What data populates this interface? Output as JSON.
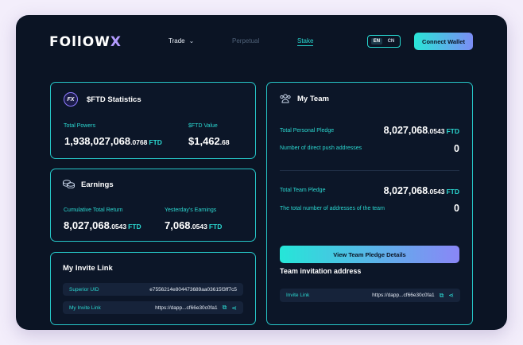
{
  "header": {
    "logo_main": "FOllOW",
    "logo_x": "X",
    "nav": {
      "trade": "Trade",
      "perpetual": "Perpetual",
      "stake": "Stake"
    },
    "lang": {
      "en": "EN",
      "cn": "CN"
    },
    "connect_label": "Connect Wallet"
  },
  "stats": {
    "icon_text": "FX",
    "title": "$FTD Statistics",
    "total_powers_label": "Total Powers",
    "total_powers_int": "1,938,027,068",
    "total_powers_dec": ".0768",
    "total_powers_unit": "FTD",
    "ftd_value_label": "$FTD Value",
    "ftd_value_int": "$1,462",
    "ftd_value_dec": ".68"
  },
  "earnings": {
    "title": "Earnings",
    "cumulative_label": "Cumulative Total Return",
    "cumulative_int": "8,027,068",
    "cumulative_dec": ".0543",
    "cumulative_unit": "FTD",
    "yesterday_label": "Yesterday's Earnings",
    "yesterday_int": "7,068",
    "yesterday_dec": ".0543",
    "yesterday_unit": "FTD"
  },
  "invite": {
    "title": "My Invite Link",
    "superior_label": "Superior UID",
    "superior_value": "e7556214e804473689aa03615f3ff7c5",
    "link_label": "My Invite Link",
    "link_value": "https://dapp...cf66e30c0fa1"
  },
  "team": {
    "title": "My Team",
    "personal_pledge_label": "Total Personal Pledge",
    "personal_pledge_int": "8,027,068",
    "personal_pledge_dec": ".0543",
    "personal_pledge_unit": "FTD",
    "direct_push_label": "Number of direct push addresses",
    "direct_push_value": "0",
    "team_pledge_label": "Total Team Pledge",
    "team_pledge_int": "8,027,068",
    "team_pledge_dec": ".0543",
    "team_pledge_unit": "FTD",
    "team_addresses_label": "The total number of addresses of the team",
    "team_addresses_value": "0",
    "view_button": "View Team Pledge Details",
    "invitation_title": "Team invitation address",
    "invite_link_label": "Invite Link",
    "invite_link_value": "https://dapp...cf66e30c0fa1"
  },
  "colors": {
    "accent": "#27d6cf",
    "background": "#0b1424",
    "violet": "#8f7bff"
  }
}
